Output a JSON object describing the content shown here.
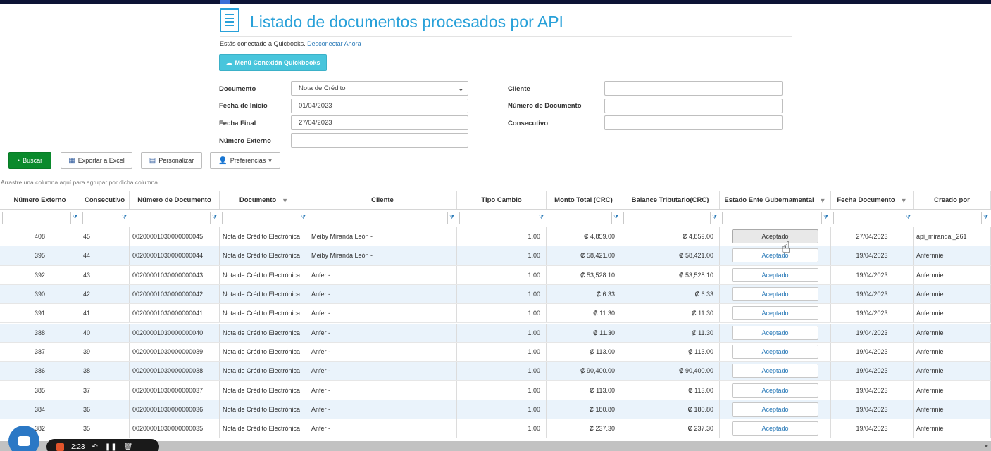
{
  "header": {
    "title": "Listado de documentos procesados por API",
    "connected_text": "Estás conectado a Quicbooks.",
    "disconnect_link": "Desconectar Ahora",
    "qb_button": "Menú Conexión Quickbooks"
  },
  "filters": {
    "documento_label": "Documento",
    "documento_value": "Nota de Crédito",
    "fecha_inicio_label": "Fecha de Inicio",
    "fecha_inicio_value": "01/04/2023",
    "fecha_final_label": "Fecha Final",
    "fecha_final_value": "27/04/2023",
    "numero_externo_label": "Número Externo",
    "numero_externo_value": "",
    "cliente_label": "Cliente",
    "cliente_value": "",
    "numero_documento_label": "Número de Documento",
    "numero_documento_value": "",
    "consecutivo_label": "Consecutivo",
    "consecutivo_value": ""
  },
  "toolbar": {
    "buscar": "Buscar",
    "exportar": "Exportar a Excel",
    "personalizar": "Personalizar",
    "preferencias": "Preferencias"
  },
  "grid": {
    "group_hint": "Arrastre una columna aquí para agrupar por dicha columna",
    "columns": [
      "Número Externo",
      "Consecutivo",
      "Número de Documento",
      "Documento",
      "Cliente",
      "Tipo Cambio",
      "Monto Total (CRC)",
      "Balance Tributario(CRC)",
      "Estado Ente Gubernamental",
      "Fecha Documento",
      "Creado por"
    ],
    "rows": [
      [
        "408",
        "45",
        "00200001030000000045",
        "Nota de Crédito Electrónica",
        "Meiby Miranda León -",
        "1.00",
        "₡ 4,859.00",
        "₡ 4,859.00",
        "Aceptado",
        "27/04/2023",
        "api_mirandal_261"
      ],
      [
        "395",
        "44",
        "00200001030000000044",
        "Nota de Crédito Electrónica",
        "Meiby Miranda León -",
        "1.00",
        "₡ 58,421.00",
        "₡ 58,421.00",
        "Aceptado",
        "19/04/2023",
        "Anfernnie"
      ],
      [
        "392",
        "43",
        "00200001030000000043",
        "Nota de Crédito Electrónica",
        "Anfer -",
        "1.00",
        "₡ 53,528.10",
        "₡ 53,528.10",
        "Aceptado",
        "19/04/2023",
        "Anfernnie"
      ],
      [
        "390",
        "42",
        "00200001030000000042",
        "Nota de Crédito Electrónica",
        "Anfer -",
        "1.00",
        "₡ 6.33",
        "₡ 6.33",
        "Aceptado",
        "19/04/2023",
        "Anfernnie"
      ],
      [
        "391",
        "41",
        "00200001030000000041",
        "Nota de Crédito Electrónica",
        "Anfer -",
        "1.00",
        "₡ 11.30",
        "₡ 11.30",
        "Aceptado",
        "19/04/2023",
        "Anfernnie"
      ],
      [
        "388",
        "40",
        "00200001030000000040",
        "Nota de Crédito Electrónica",
        "Anfer -",
        "1.00",
        "₡ 11.30",
        "₡ 11.30",
        "Aceptado",
        "19/04/2023",
        "Anfernnie"
      ],
      [
        "387",
        "39",
        "00200001030000000039",
        "Nota de Crédito Electrónica",
        "Anfer -",
        "1.00",
        "₡ 113.00",
        "₡ 113.00",
        "Aceptado",
        "19/04/2023",
        "Anfernnie"
      ],
      [
        "386",
        "38",
        "00200001030000000038",
        "Nota de Crédito Electrónica",
        "Anfer -",
        "1.00",
        "₡ 90,400.00",
        "₡ 90,400.00",
        "Aceptado",
        "19/04/2023",
        "Anfernnie"
      ],
      [
        "385",
        "37",
        "00200001030000000037",
        "Nota de Crédito Electrónica",
        "Anfer -",
        "1.00",
        "₡ 113.00",
        "₡ 113.00",
        "Aceptado",
        "19/04/2023",
        "Anfernnie"
      ],
      [
        "384",
        "36",
        "00200001030000000036",
        "Nota de Crédito Electrónica",
        "Anfer -",
        "1.00",
        "₡ 180.80",
        "₡ 180.80",
        "Aceptado",
        "19/04/2023",
        "Anfernnie"
      ],
      [
        "382",
        "35",
        "00200001030000000035",
        "Nota de Crédito Electrónica",
        "Anfer -",
        "1.00",
        "₡ 237.30",
        "₡ 237.30",
        "Aceptado",
        "19/04/2023",
        "Anfernnie"
      ]
    ]
  },
  "recorder": {
    "time": "2:23"
  }
}
